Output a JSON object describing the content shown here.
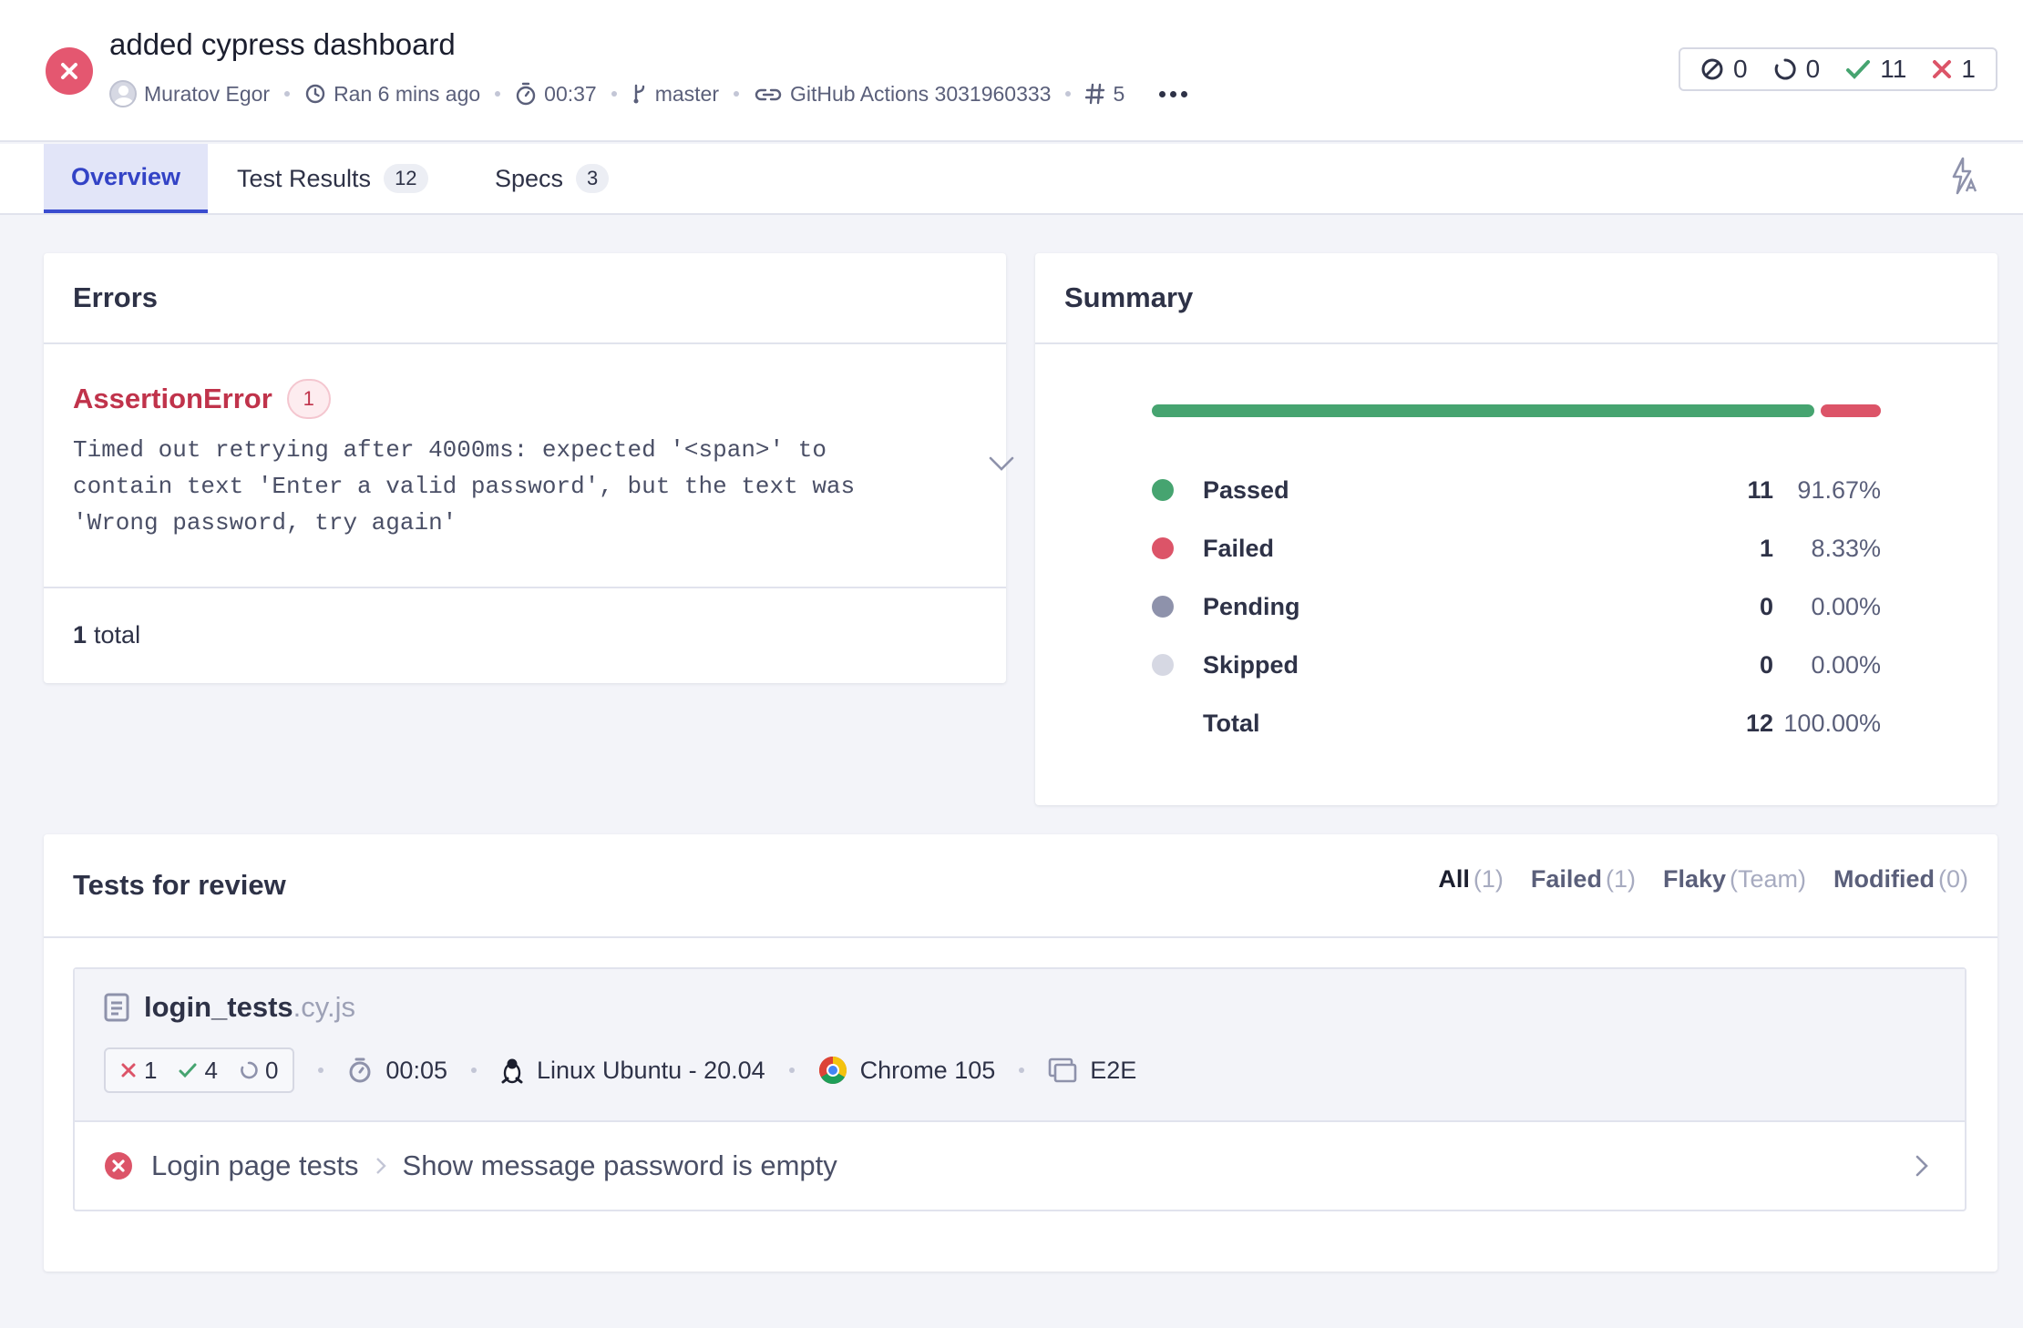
{
  "run": {
    "title": "added cypress dashboard",
    "status": "failed",
    "author": "Muratov Egor",
    "ran": "Ran 6 mins ago",
    "duration": "00:37",
    "branch": "master",
    "ci": "GitHub Actions 3031960333",
    "build_number": "5"
  },
  "counters": {
    "skipped": "0",
    "pending": "0",
    "passed": "11",
    "failed": "1"
  },
  "tabs": [
    {
      "label": "Overview",
      "badge": ""
    },
    {
      "label": "Test Results",
      "badge": "12"
    },
    {
      "label": "Specs",
      "badge": "3"
    }
  ],
  "errors": {
    "heading": "Errors",
    "name": "AssertionError",
    "count": "1",
    "message": "Timed out retrying after 4000ms: expected '<span>' to contain text 'Enter a valid password', but the text was 'Wrong password, try again'",
    "total_count": "1",
    "total_label": "total"
  },
  "summary": {
    "heading": "Summary",
    "rows": [
      {
        "label": "Passed",
        "count": "11",
        "pct": "91.67%",
        "color": "#46a470"
      },
      {
        "label": "Failed",
        "count": "1",
        "pct": "8.33%",
        "color": "#dc5468"
      },
      {
        "label": "Pending",
        "count": "0",
        "pct": "0.00%",
        "color": "#8e92ab"
      },
      {
        "label": "Skipped",
        "count": "0",
        "pct": "0.00%",
        "color": "#d6d8e3"
      },
      {
        "label": "Total",
        "count": "12",
        "pct": "100.00%",
        "color": ""
      }
    ],
    "bar": {
      "passed_fraction": 0.9167,
      "failed_fraction": 0.0833
    }
  },
  "review": {
    "heading": "Tests for review",
    "filters": [
      {
        "label": "All",
        "count": "(1)"
      },
      {
        "label": "Failed",
        "count": "(1)"
      },
      {
        "label": "Flaky",
        "count": "(Team)"
      },
      {
        "label": "Modified",
        "count": "(0)"
      }
    ],
    "spec": {
      "name": "login_tests",
      "ext": ".cy.js",
      "failed": "1",
      "passed": "4",
      "pending": "0",
      "duration": "00:05",
      "os": "Linux Ubuntu - 20.04",
      "browser": "Chrome 105",
      "type": "E2E"
    },
    "test": {
      "suite": "Login page tests",
      "title": "Show message password is empty"
    }
  },
  "colors": {
    "accent": "#3a4ccf",
    "pass": "#46a470",
    "fail": "#dc5468"
  }
}
